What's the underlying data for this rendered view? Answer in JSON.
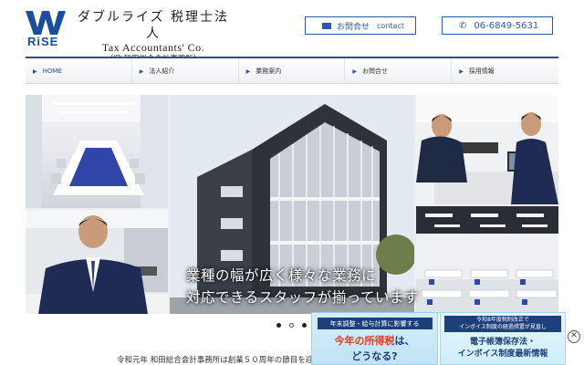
{
  "brand": {
    "logo_text": "RiSE",
    "name_jp": "ダブルライズ 税理士法人",
    "name_en": "Tax Accountants' Co.",
    "former_name": "（旧 和田総合会計事務所）",
    "color": "#1a4d9c"
  },
  "header": {
    "contact_label": "お問合せ",
    "contact_en": "contact",
    "tel_label": "06-6849-5631",
    "mail_icon": "mail-icon",
    "phone_icon": "phone-icon"
  },
  "nav": {
    "items": [
      {
        "label": "HOME"
      },
      {
        "label": "法人紹介"
      },
      {
        "label": "業務案内"
      },
      {
        "label": "お問合せ"
      },
      {
        "label": "採用情報"
      }
    ]
  },
  "hero": {
    "caption_line1": "業種の幅が広く様々な業務に",
    "caption_line2": "対応できるスタッフが揃っています"
  },
  "slider": {
    "dots_total": 3,
    "active_index": 1
  },
  "intro": {
    "text": "令和元年 和田総合会計事務所は創業５０周年の節目を迎え"
  },
  "banner_a": {
    "top_text": "年末調整・給与計算に影響する",
    "mid_em": "今年の所得税",
    "mid_tail": "は、",
    "bottom": "どうなる?"
  },
  "banner_b": {
    "top_line1": "令和8年度税制改正で",
    "top_line2": "インボイス制度の経過措置が見直し",
    "line1": "電子帳簿保存法・",
    "line2": "インボイス制度最新情報"
  },
  "close_label": "✕",
  "colors": {
    "accent": "#2d5aa8",
    "nav_border": "#2d4f95",
    "banner_dark": "#1d3f7a",
    "banner_red": "#e8391d"
  }
}
